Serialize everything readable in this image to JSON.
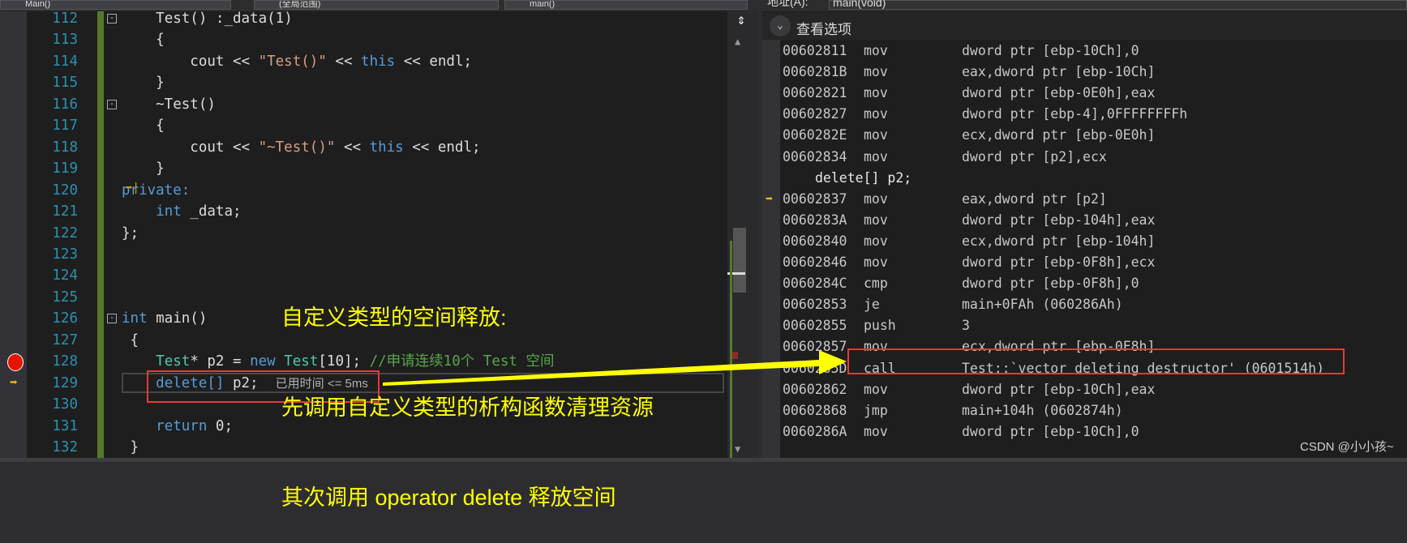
{
  "tabs": [
    "Main()",
    "(全局范围)",
    "main()"
  ],
  "editor": {
    "lines": [
      {
        "n": "112",
        "fold": true,
        "seg": [
          [
            "    ",
            "plain"
          ],
          [
            "Test() :_data(1)",
            "plain"
          ]
        ]
      },
      {
        "n": "113",
        "seg": [
          [
            "    {",
            "plain"
          ]
        ]
      },
      {
        "n": "114",
        "seg": [
          [
            "        cout << ",
            "plain"
          ],
          [
            "\"Test()\"",
            "str"
          ],
          [
            " << ",
            "plain"
          ],
          [
            "this",
            "kw"
          ],
          [
            " << endl;",
            "plain"
          ]
        ]
      },
      {
        "n": "115",
        "seg": [
          [
            "    }",
            "plain"
          ]
        ]
      },
      {
        "n": "116",
        "fold": true,
        "seg": [
          [
            "    ~Test()",
            "plain"
          ]
        ]
      },
      {
        "n": "117",
        "seg": [
          [
            "    {",
            "plain"
          ]
        ]
      },
      {
        "n": "118",
        "seg": [
          [
            "        cout << ",
            "plain"
          ],
          [
            "\"~Test()\"",
            "str"
          ],
          [
            " << ",
            "plain"
          ],
          [
            "this",
            "kw"
          ],
          [
            " << endl;",
            "plain"
          ]
        ]
      },
      {
        "n": "119",
        "seg": [
          [
            "    }",
            "plain"
          ]
        ]
      },
      {
        "n": "120",
        "seg": [
          [
            "private:",
            "kw"
          ]
        ]
      },
      {
        "n": "121",
        "seg": [
          [
            "    ",
            "plain"
          ],
          [
            "int",
            "kw"
          ],
          [
            " _data;",
            "plain"
          ]
        ]
      },
      {
        "n": "122",
        "seg": [
          [
            "};",
            "plain"
          ]
        ]
      },
      {
        "n": "123",
        "seg": []
      },
      {
        "n": "124",
        "seg": []
      },
      {
        "n": "125",
        "seg": []
      },
      {
        "n": "126",
        "fold": true,
        "seg": [
          [
            "int",
            "kw"
          ],
          [
            " main()",
            "plain"
          ]
        ]
      },
      {
        "n": "127",
        "seg": [
          [
            " {",
            "plain"
          ]
        ]
      },
      {
        "n": "128",
        "seg": [
          [
            "    ",
            "plain"
          ],
          [
            "Test",
            "type"
          ],
          [
            "* p2 = ",
            "plain"
          ],
          [
            "new",
            "kw"
          ],
          [
            " ",
            "plain"
          ],
          [
            "Test",
            "type"
          ],
          [
            "[10]; ",
            "plain"
          ],
          [
            "//申请连续10个 Test 空间",
            "cmt"
          ]
        ]
      },
      {
        "n": "129",
        "seg": [
          [
            "    ",
            "plain"
          ],
          [
            "delete[]",
            "kw"
          ],
          [
            " p2;  ",
            "plain"
          ],
          [
            "已用时间 <= 5ms",
            "hint"
          ]
        ]
      },
      {
        "n": "130",
        "seg": []
      },
      {
        "n": "131",
        "seg": [
          [
            "    ",
            "plain"
          ],
          [
            "return",
            "kw"
          ],
          [
            " 0;",
            "plain"
          ]
        ]
      },
      {
        "n": "132",
        "seg": [
          [
            " }",
            "plain"
          ]
        ]
      }
    ],
    "breakpoint_line": "128",
    "current_line": "129"
  },
  "annotation": [
    "自定义类型的空间释放:",
    "先调用自定义类型的析构函数清理资源",
    "其次调用 operator delete 释放空间"
  ],
  "disasm": {
    "address_label": "地址(A):",
    "address_value": "main(void)",
    "view_options": "查看选项",
    "rows": [
      {
        "addr": "00602811",
        "op": "mov",
        "args": "dword ptr [ebp-10Ch],0"
      },
      {
        "addr": "0060281B",
        "op": "mov",
        "args": "eax,dword ptr [ebp-10Ch]"
      },
      {
        "addr": "00602821",
        "op": "mov",
        "args": "dword ptr [ebp-0E0h],eax"
      },
      {
        "addr": "00602827",
        "op": "mov",
        "args": "dword ptr [ebp-4],0FFFFFFFFh"
      },
      {
        "addr": "0060282E",
        "op": "mov",
        "args": "ecx,dword ptr [ebp-0E0h]"
      },
      {
        "addr": "00602834",
        "op": "mov",
        "args": "dword ptr [p2],ecx"
      },
      {
        "source": "delete[] p2;"
      },
      {
        "addr": "00602837",
        "op": "mov",
        "args": "eax,dword ptr [p2]",
        "current": true
      },
      {
        "addr": "0060283A",
        "op": "mov",
        "args": "dword ptr [ebp-104h],eax"
      },
      {
        "addr": "00602840",
        "op": "mov",
        "args": "ecx,dword ptr [ebp-104h]"
      },
      {
        "addr": "00602846",
        "op": "mov",
        "args": "dword ptr [ebp-0F8h],ecx"
      },
      {
        "addr": "0060284C",
        "op": "cmp",
        "args": "dword ptr [ebp-0F8h],0"
      },
      {
        "addr": "00602853",
        "op": "je",
        "args": "main+0FAh (060286Ah)"
      },
      {
        "addr": "00602855",
        "op": "push",
        "args": "3"
      },
      {
        "addr": "00602857",
        "op": "mov",
        "args": "ecx,dword ptr [ebp-0F8h]"
      },
      {
        "addr": "0060285D",
        "op": "call",
        "args": "Test::`vector deleting destructor' (0601514h)",
        "highlighted": true
      },
      {
        "addr": "00602862",
        "op": "mov",
        "args": "dword ptr [ebp-10Ch],eax"
      },
      {
        "addr": "00602868",
        "op": "jmp",
        "args": "main+104h (0602874h)"
      },
      {
        "addr": "0060286A",
        "op": "mov",
        "args": "dword ptr [ebp-10Ch],0"
      }
    ]
  },
  "watermark": "CSDN @小小孩~",
  "colors": {
    "annotation": "#ffff00",
    "highlight_box": "#e8383a",
    "keyword": "#569cd6",
    "string": "#d69d85",
    "comment": "#57a64a",
    "type": "#4ec9b0"
  }
}
